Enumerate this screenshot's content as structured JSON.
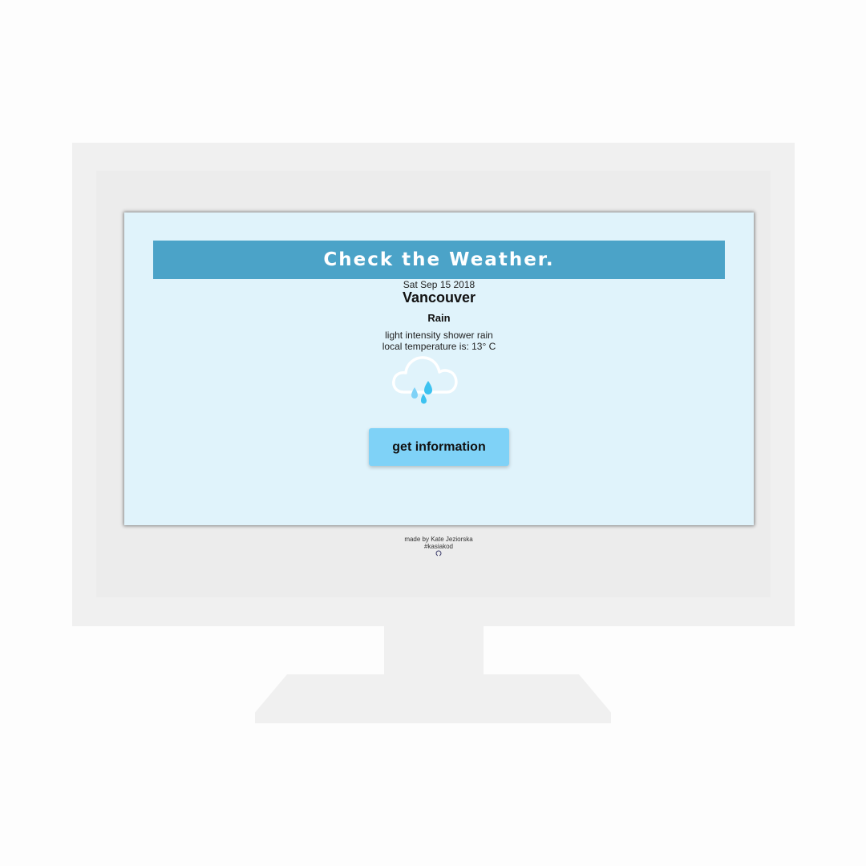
{
  "app": {
    "title": "Check the Weather.",
    "date": "Sat Sep 15 2018",
    "city": "Vancouver",
    "condition": "Rain",
    "description": "light intensity shower rain",
    "temperature_text": "local temperature is: 13° C",
    "weather_icon": "rain-cloud-icon",
    "button_label": "get information"
  },
  "footer": {
    "credit": "made by Kate Jeziorska",
    "tag": "#kasiakod",
    "link_icon": "github-icon"
  },
  "colors": {
    "screen_background": "#e0f3fb",
    "banner": "#4ba3c8",
    "button": "#7fd2f7",
    "raindrop_light": "#7fd2f7",
    "raindrop_dark": "#3dc2f0"
  }
}
